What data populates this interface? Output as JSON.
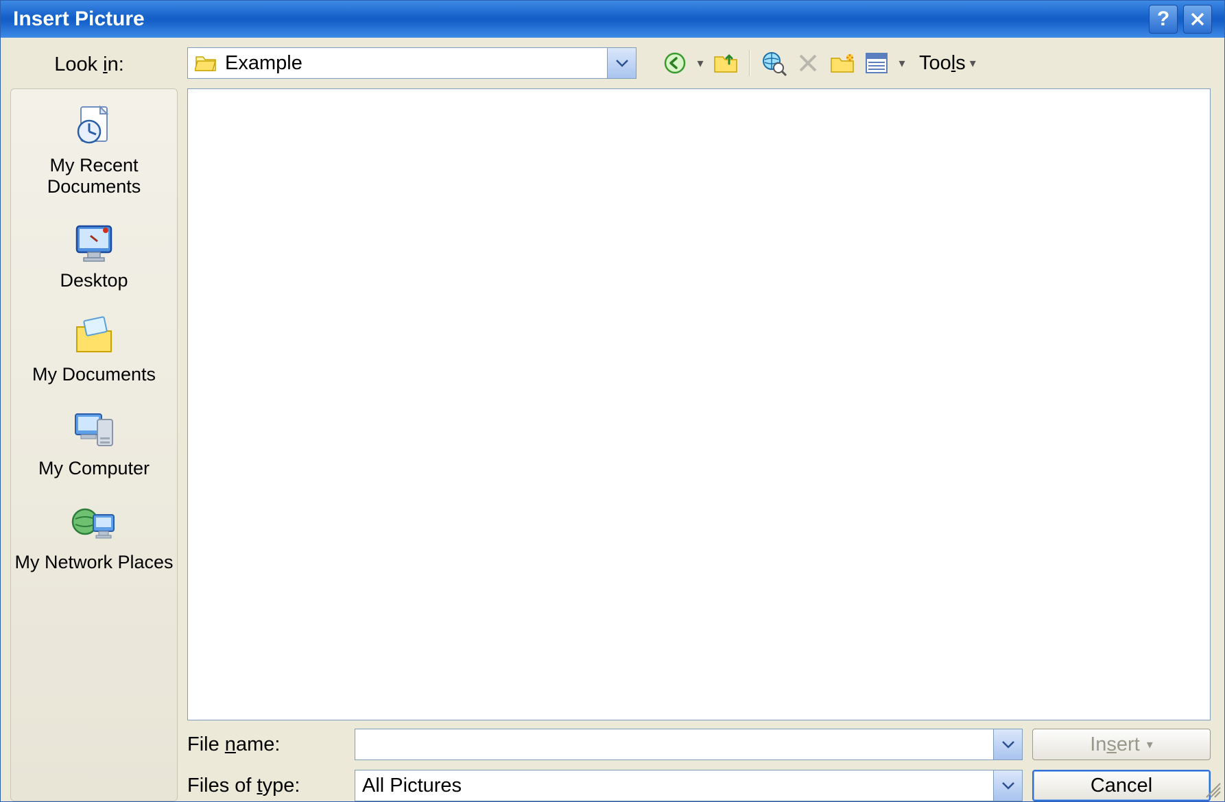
{
  "window": {
    "title": "Insert Picture"
  },
  "titlebar_buttons": {
    "help_label": "?",
    "close_label": "X"
  },
  "toprow": {
    "lookin_label_pre": "Look ",
    "lookin_label_u": "i",
    "lookin_label_post": "n:",
    "lookin_value": "Example",
    "tools_label_pre": "Too",
    "tools_label_u": "l",
    "tools_label_post": "s"
  },
  "sidebar": {
    "places": [
      {
        "label": "My Recent Documents"
      },
      {
        "label": "Desktop"
      },
      {
        "label": "My Documents"
      },
      {
        "label": "My Computer"
      },
      {
        "label": "My Network Places"
      }
    ]
  },
  "bottom": {
    "filename_label_pre": "File ",
    "filename_label_u": "n",
    "filename_label_post": "ame:",
    "filename_value": "",
    "filetype_label_pre": "Files of ",
    "filetype_label_u": "t",
    "filetype_label_post": "ype:",
    "filetype_value": "All Pictures",
    "insert_pre": "In",
    "insert_u": "s",
    "insert_post": "ert",
    "cancel_label": "Cancel"
  }
}
